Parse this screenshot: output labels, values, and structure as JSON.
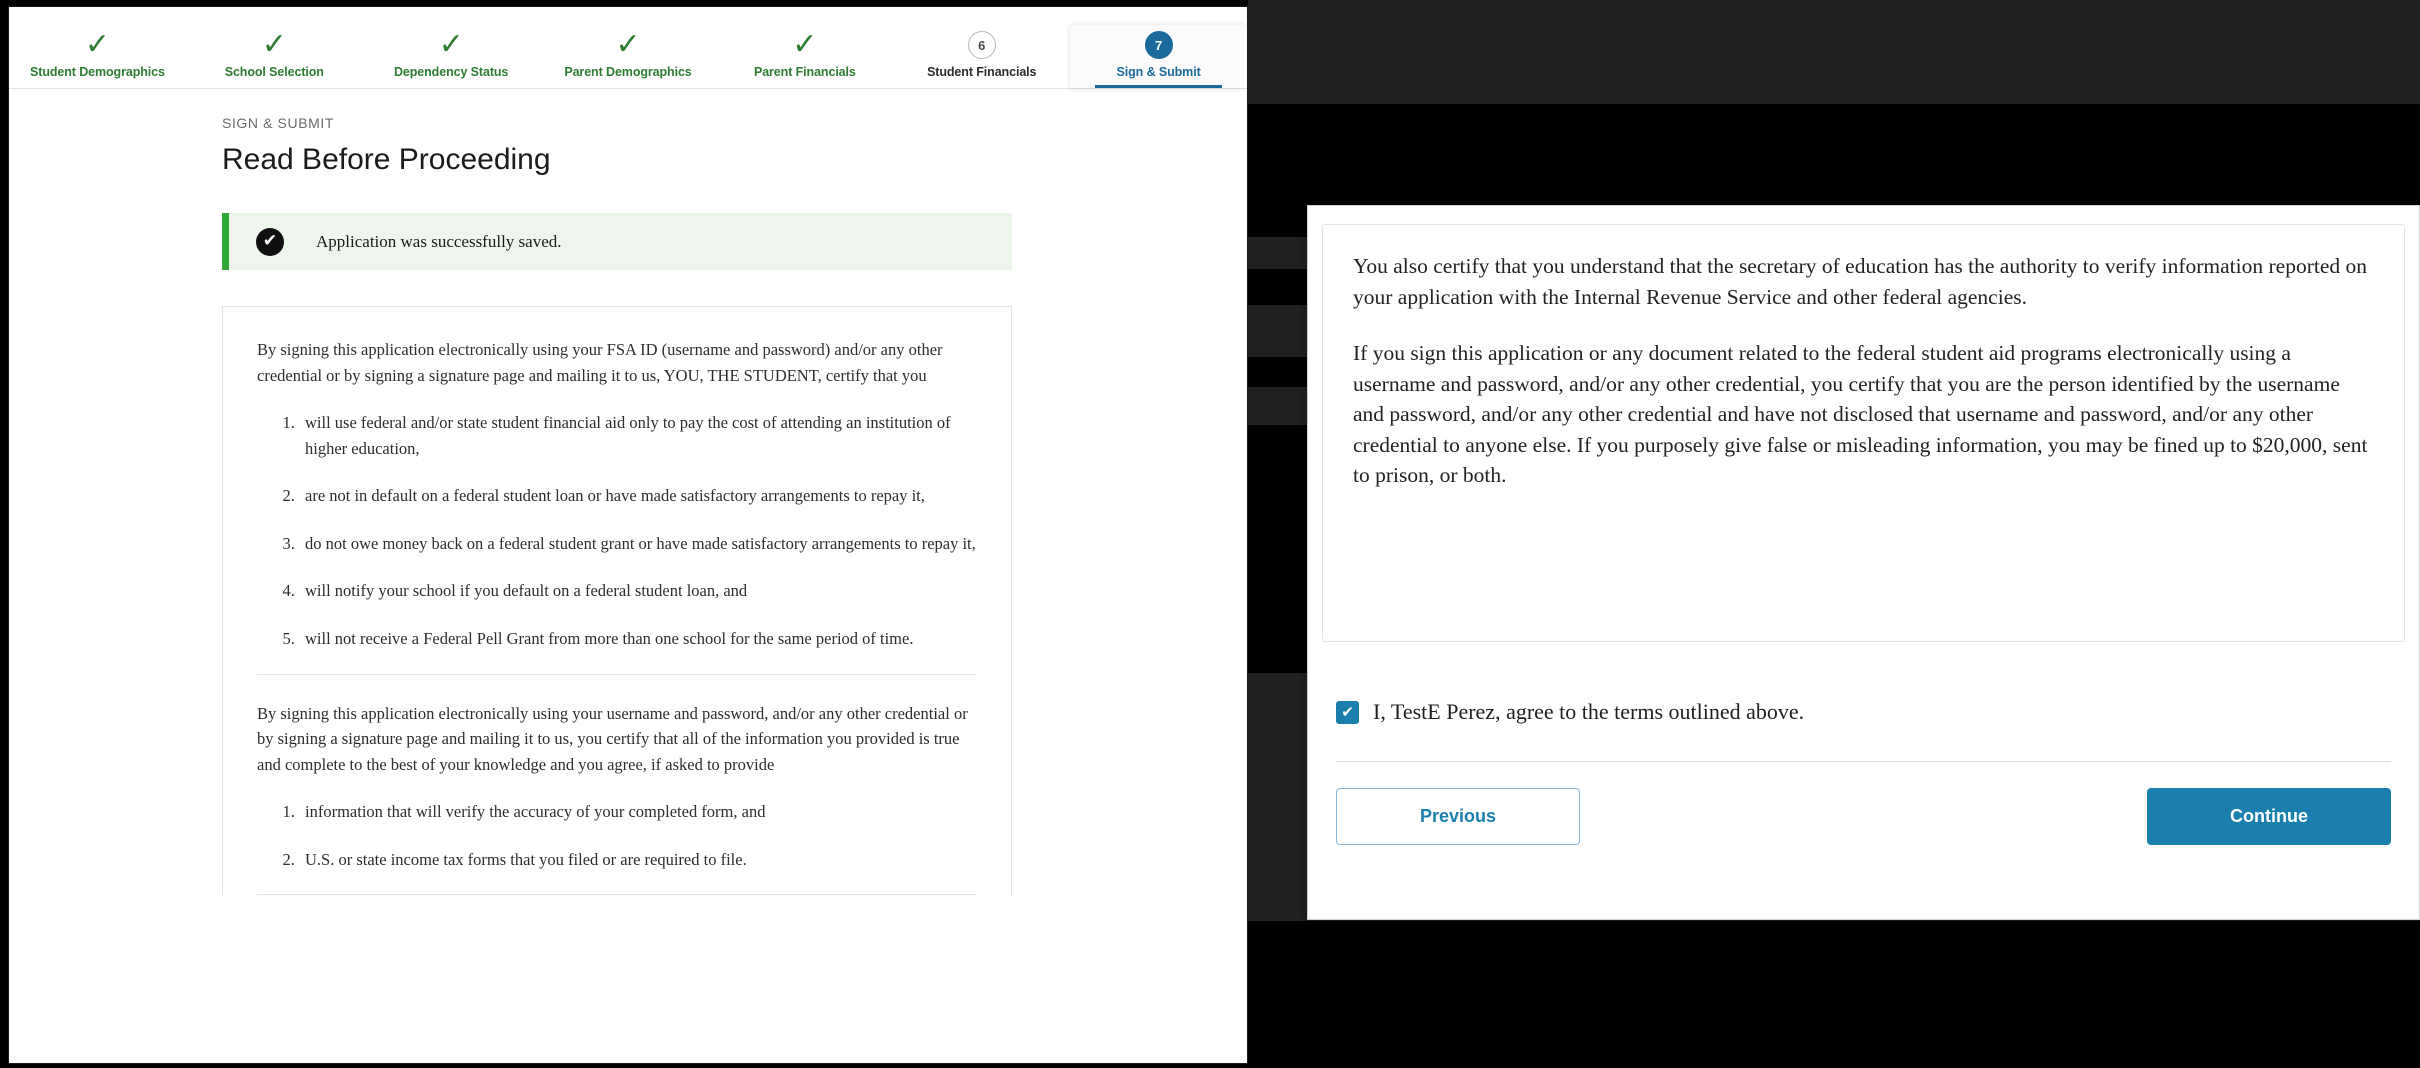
{
  "stepper": {
    "steps": [
      {
        "label": "Student Demographics",
        "state": "complete",
        "marker": "check"
      },
      {
        "label": "School Selection",
        "state": "complete",
        "marker": "check"
      },
      {
        "label": "Dependency Status",
        "state": "complete",
        "marker": "check"
      },
      {
        "label": "Parent Demographics",
        "state": "complete",
        "marker": "check"
      },
      {
        "label": "Parent Financials",
        "state": "complete",
        "marker": "check"
      },
      {
        "label": "Student Financials",
        "state": "todo",
        "marker": "6"
      },
      {
        "label": "Sign & Submit",
        "state": "active",
        "marker": "7"
      }
    ]
  },
  "page": {
    "eyebrow": "SIGN & SUBMIT",
    "title": "Read Before Proceeding"
  },
  "alert": {
    "message": "Application was successfully saved.",
    "icon": "check-circle-icon",
    "accent_color": "#2ea836",
    "background_color": "#eef5ec"
  },
  "terms_card": {
    "intro_paragraph": "By signing this application electronically using your FSA ID (username and password) and/or any other credential or by signing a signature page and mailing it to us, YOU, THE STUDENT, certify that you",
    "certify_list": [
      "will use federal and/or state student financial aid only to pay the cost of attending an institution of higher education,",
      "are not in default on a federal student loan or have made satisfactory arrangements to repay it,",
      "do not owe money back on a federal student grant or have made satisfactory arrangements to repay it,",
      "will notify your school if you default on a federal student loan, and",
      "will not receive a Federal Pell Grant from more than one school for the same period of time."
    ],
    "second_paragraph": "By signing this application electronically using your username and password, and/or any other credential or by signing a signature page and mailing it to us, you certify that all of the information you provided is true and complete to the best of your knowledge and you agree, if asked to provide",
    "provide_list": [
      "information that will verify the accuracy of your completed form, and",
      "U.S. or state income tax forms that you filed or are required to file."
    ]
  },
  "modal": {
    "paragraphs": [
      "You also certify that you understand that the secretary of education has the authority to verify information reported on your application with the Internal Revenue Service and other federal agencies.",
      "If you sign this application or any document related to the federal student aid programs electronically using a username and password, and/or any other credential, you certify that you are the person identified by the username and password, and/or any other credential and have not disclosed that username and password, and/or any other credential to anyone else. If you purposely give false or misleading information, you may be fined up to $20,000, sent to prison, or both."
    ],
    "agree": {
      "label": "I, TestE Perez, agree to the terms outlined above.",
      "checked": true,
      "checkbox_color": "#1b7fae",
      "check_glyph": "✔"
    },
    "buttons": {
      "previous": "Previous",
      "continue": "Continue"
    }
  },
  "colors": {
    "accent_blue": "#1b7fae",
    "step_active_blue": "#1b6a9c",
    "complete_green": "#2e7d32",
    "backdrop": "#000000"
  },
  "glyphs": {
    "check": "✓",
    "check_bold": "✔"
  }
}
